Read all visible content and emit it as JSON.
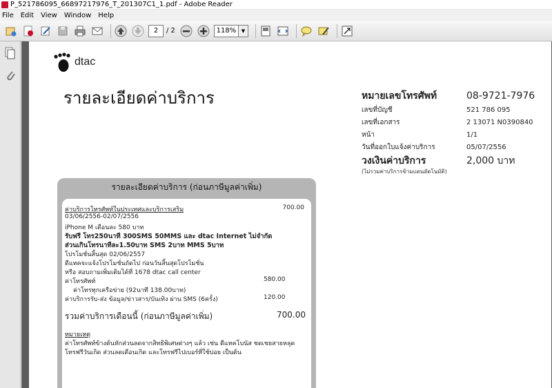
{
  "window": {
    "title": "P_521786095_66897217976_T_201307C1_1.pdf - Adobe Reader"
  },
  "menu": [
    "File",
    "Edit",
    "View",
    "Window",
    "Help"
  ],
  "toolbar": {
    "page_current": "2",
    "page_total": "/ 2",
    "zoom": "118%"
  },
  "document": {
    "logo_text": "dtac",
    "title": "รายละเอียดค่าบริการ",
    "info": [
      {
        "label": "หมายเลขโทรศัพท์",
        "value": "08-9721-7976",
        "big": true
      },
      {
        "label": "เลขที่บัญชี",
        "value": "521 786 095"
      },
      {
        "label": "เลขที่เอกสาร",
        "value": "2 13071 N0390840"
      },
      {
        "label": "หน้า",
        "value": "1/1"
      },
      {
        "label": "วันที่ออกใบแจ้งค่าบริการ",
        "value": "05/07/2556"
      },
      {
        "label": "วงเงินค่าบริการ",
        "value": "2,000 บาท",
        "big": true
      }
    ],
    "info_note": "(ไม่รวมค่าบริการข้ามแดนอัตโนมัติ)",
    "panel_title": "รายละเอียดค่าบริการ (ก่อนภาษีมูลค่าเพิ่ม)",
    "section_title": "ค่าบริการโทรศัพท์ในประเทศและบริการเสริม",
    "section_amount": "700.00",
    "period": "03/06/2556-02/07/2556",
    "package_name": "iPhone M เดือนละ 580 บาท",
    "package_detail_1": "รับฟรี โทร250นาที 300SMS 50MMS และ dtac Internet ไม่จำกัด",
    "package_detail_2": "ส่วนเกินโทรนาทีละ1.50บาท SMS 2บาท MMS 5บาท",
    "promo_end": "โปรโมชั่นสิ้นสุด 02/06/2557",
    "promo_note_1": "ดีแทคจะแจ้งโปรโมชั่นถัดไป ก่อนวันสิ้นสุดโปรโมชั่น",
    "promo_note_2": "หรือ สอบถามเพิ่มเติมได้ที่ 1678 dtac call center",
    "call_label": "ค่าโทรศัพท์",
    "call_amount": "580.00",
    "call_detail": "ค่าโทรทุกเครือข่าย (92นาที 138.00บาท)",
    "sms_label": "ค่าบริการรับ-ส่ง ข้อมูล/ข่าวสาร/บันเทิง ผ่าน SMS (6ครั้ง)",
    "sms_amount": "120.00",
    "total_label": "รวมค่าบริการเดือนนี้ (ก่อนภาษีมูลค่าเพิ่ม)",
    "total_amount": "700.00",
    "remark_title": "หมายเหตุ",
    "remark_1": "ค่าโทรศัพท์ข้างต้นหักส่วนลดจากสิทธิพิเศษต่างๆ แล้ว เช่น ดีแทคโบนัส ชดเชยสายหลุด",
    "remark_2": "โทรฟรีวันเกิด ส่วนลดเดือนเกิด และโทรฟรีไปเบอร์ที่ใช้บ่อย เป็นต้น"
  },
  "colors": {
    "panel": "#b5b5b5",
    "viewer_bg": "#5d5d5d",
    "page": "#ffffff"
  }
}
